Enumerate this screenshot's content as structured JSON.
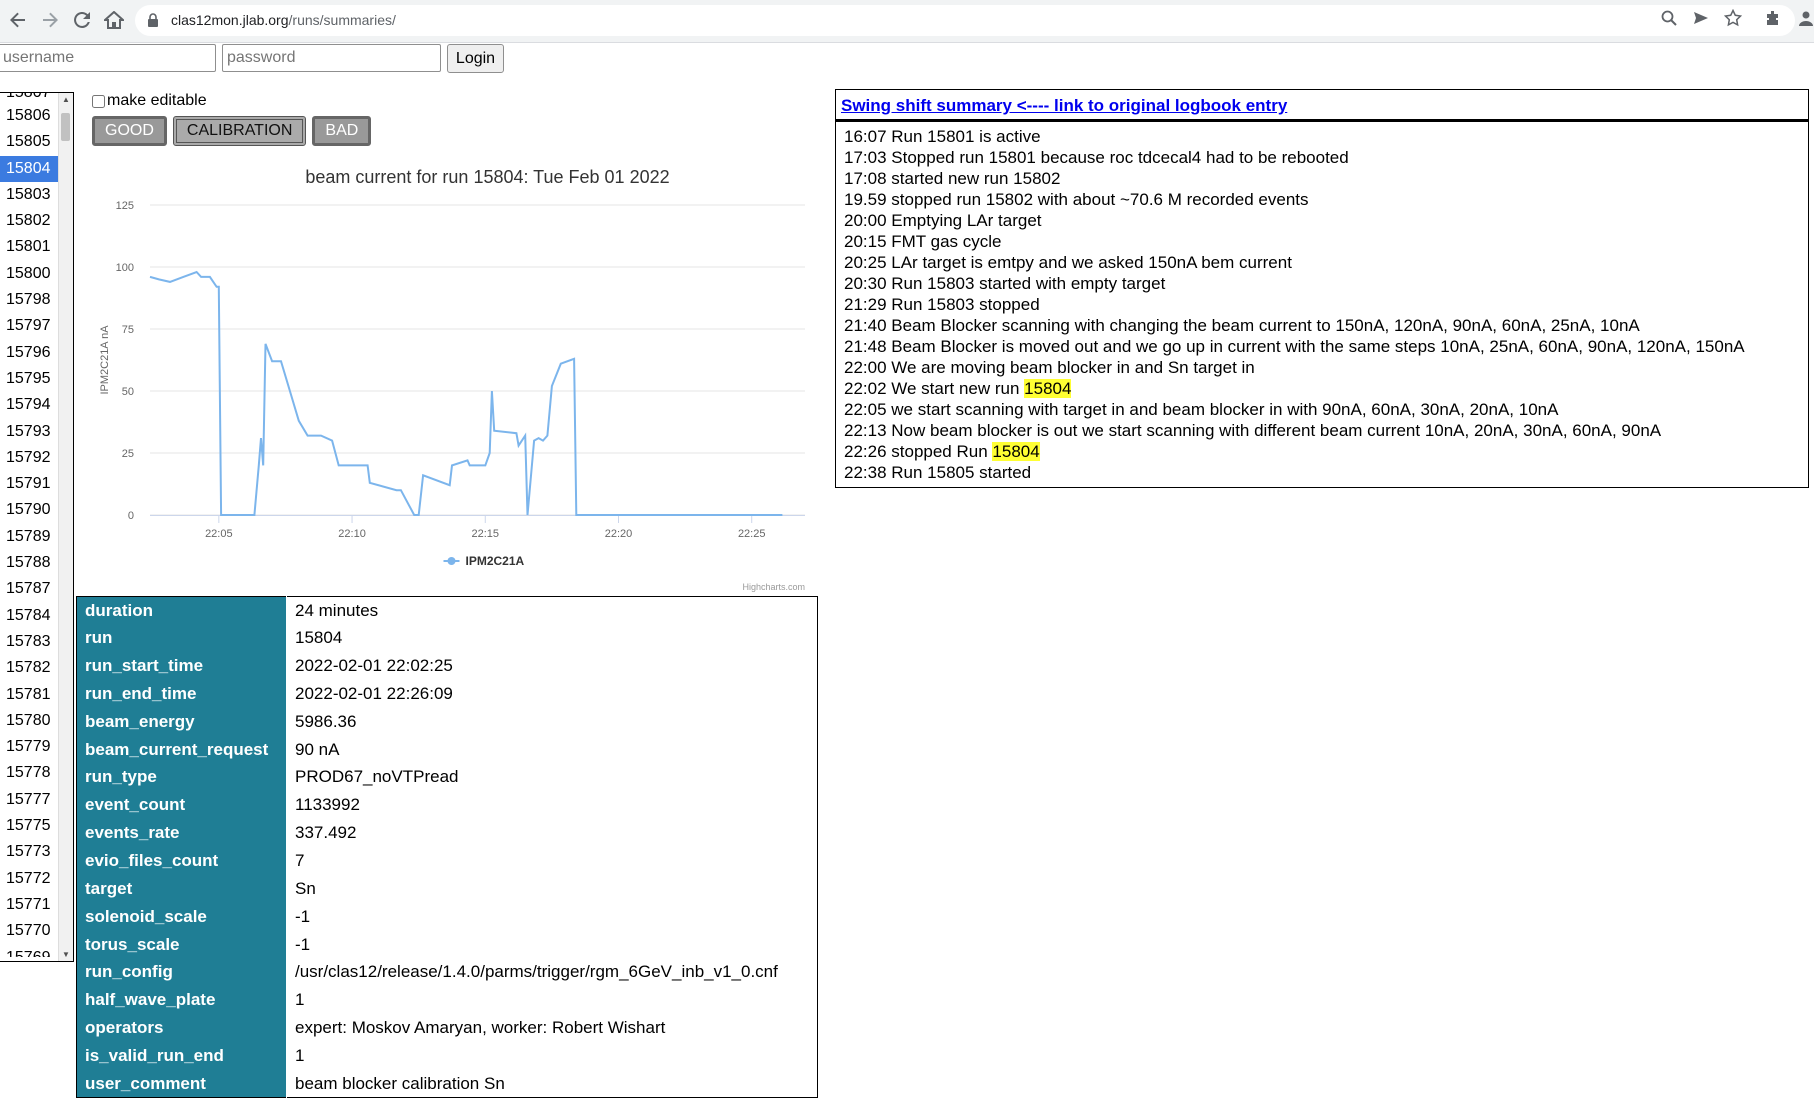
{
  "browser": {
    "url_host": "clas12mon.jlab.org",
    "url_path": "/runs/summaries/"
  },
  "login": {
    "username_placeholder": "username",
    "password_placeholder": "password",
    "button": "Login"
  },
  "runs": {
    "partial_top": "15807",
    "items": [
      "15806",
      "15805",
      "15804",
      "15803",
      "15802",
      "15801",
      "15800",
      "15798",
      "15797",
      "15796",
      "15795",
      "15794",
      "15793",
      "15792",
      "15791",
      "15790",
      "15789",
      "15788",
      "15787",
      "15784",
      "15783",
      "15782",
      "15781",
      "15780",
      "15779",
      "15778",
      "15777",
      "15775",
      "15773",
      "15772",
      "15771",
      "15770"
    ],
    "partial_bottom": "15769",
    "selected": "15804"
  },
  "controls": {
    "make_editable": "make editable",
    "good": "GOOD",
    "calibration": "CALIBRATION",
    "bad": "BAD"
  },
  "chart_data": {
    "type": "line",
    "title": "beam current for run 15804: Tue Feb 01 2022",
    "ylabel": "IPM2C21A nA",
    "xlabel": "",
    "ylim": [
      0,
      125
    ],
    "yticks": [
      "0",
      "25",
      "50",
      "75",
      "100",
      "125"
    ],
    "xticks": [
      "22:05",
      "22:10",
      "22:15",
      "22:20",
      "22:25"
    ],
    "credits": "Highcharts.com",
    "grid": true,
    "legend": "bottom-center",
    "series": [
      {
        "name": "IPM2C21A",
        "color": "#7cb5ec",
        "x": [
          "22:02:25",
          "22:02:45",
          "22:03:10",
          "22:03:40",
          "22:04:10",
          "22:04:20",
          "22:04:40",
          "22:04:55",
          "22:05:00",
          "22:05:05",
          "22:06:20",
          "22:06:30",
          "22:06:35",
          "22:06:40",
          "22:06:45",
          "22:07:00",
          "22:07:20",
          "22:07:40",
          "22:08:00",
          "22:08:20",
          "22:08:35",
          "22:08:50",
          "22:09:15",
          "22:09:30",
          "22:10:00",
          "22:10:35",
          "22:10:40",
          "22:11:40",
          "22:11:50",
          "22:12:20",
          "22:12:30",
          "22:12:40",
          "22:13:40",
          "22:13:45",
          "22:14:20",
          "22:14:25",
          "22:15:00",
          "22:15:10",
          "22:15:15",
          "22:15:20",
          "22:16:10",
          "22:16:15",
          "22:16:30",
          "22:16:35",
          "22:16:50",
          "22:17:00",
          "22:17:10",
          "22:17:20",
          "22:17:30",
          "22:17:50",
          "22:18:20",
          "22:18:25",
          "22:26:09"
        ],
        "values": [
          96,
          95,
          94,
          96,
          98,
          96,
          96,
          92,
          92,
          0,
          0,
          20,
          31,
          20,
          69,
          62,
          62,
          50,
          38,
          32,
          32,
          32,
          30,
          20,
          20,
          20,
          13,
          10,
          10,
          0,
          0,
          16,
          12,
          20,
          22,
          20,
          20,
          25,
          50,
          34,
          33,
          28,
          32,
          0,
          30,
          31,
          30,
          32,
          52,
          61,
          63,
          0,
          0
        ]
      }
    ]
  },
  "summary": {
    "rows": [
      {
        "k": "duration",
        "v": "24 minutes"
      },
      {
        "k": "run",
        "v": "15804"
      },
      {
        "k": "run_start_time",
        "v": "2022-02-01 22:02:25"
      },
      {
        "k": "run_end_time",
        "v": "2022-02-01 22:26:09"
      },
      {
        "k": "beam_energy",
        "v": "5986.36"
      },
      {
        "k": "beam_current_request",
        "v": "90 nA"
      },
      {
        "k": "run_type",
        "v": "PROD67_noVTPread"
      },
      {
        "k": "event_count",
        "v": "1133992"
      },
      {
        "k": "events_rate",
        "v": "337.492"
      },
      {
        "k": "evio_files_count",
        "v": "7"
      },
      {
        "k": "target",
        "v": "Sn"
      },
      {
        "k": "solenoid_scale",
        "v": "-1"
      },
      {
        "k": "torus_scale",
        "v": "-1"
      },
      {
        "k": "run_config",
        "v": "/usr/clas12/release/1.4.0/parms/trigger/rgm_6GeV_inb_v1_0.cnf"
      },
      {
        "k": "half_wave_plate",
        "v": "1"
      },
      {
        "k": "operators",
        "v": "expert: Moskov Amaryan, worker: Robert Wishart"
      },
      {
        "k": "is_valid_run_end",
        "v": "1"
      },
      {
        "k": "user_comment",
        "v": "beam blocker calibration Sn"
      }
    ]
  },
  "shift": {
    "link": "Swing shift summary <---- link to original logbook entry",
    "highlight_color": "#ffff33",
    "lines": [
      {
        "text": "16:07 Run 15801 is active"
      },
      {
        "text": "17:03 Stopped run 15801 because roc tdcecal4 had to be rebooted"
      },
      {
        "text": "17:08 started new run 15802"
      },
      {
        "text": "19.59 stopped run 15802 with about ~70.6 M recorded events"
      },
      {
        "text": "20:00 Emptying LAr target"
      },
      {
        "text": "20:15 FMT gas cycle"
      },
      {
        "text": "20:25 LAr target is emtpy and we asked 150nA bem current"
      },
      {
        "text": "20:30 Run 15803 started with empty target"
      },
      {
        "text": "21:29 Run 15803 stopped"
      },
      {
        "text": "21:40 Beam Blocker scanning with changing the beam current to 150nA, 120nA, 90nA, 60nA, 25nA, 10nA"
      },
      {
        "text": "21:48 Beam Blocker is moved out and we go up in current with the same steps 10nA, 25nA, 60nA, 90nA, 120nA, 150nA"
      },
      {
        "text": "22:00 We are moving beam blocker in and Sn target in"
      },
      {
        "text": "22:02 We start new run ",
        "hl": "15804"
      },
      {
        "text": "22:05 we start scanning with target in and beam blocker in with 90nA, 60nA, 30nA, 20nA, 10nA"
      },
      {
        "text": "22:13 Now beam blocker is out we start scanning with different beam current 10nA, 20nA, 30nA, 60nA, 90nA"
      },
      {
        "text": "22:26 stopped Run ",
        "hl": "15804"
      },
      {
        "text": "22:38 Run 15805 started"
      }
    ]
  }
}
